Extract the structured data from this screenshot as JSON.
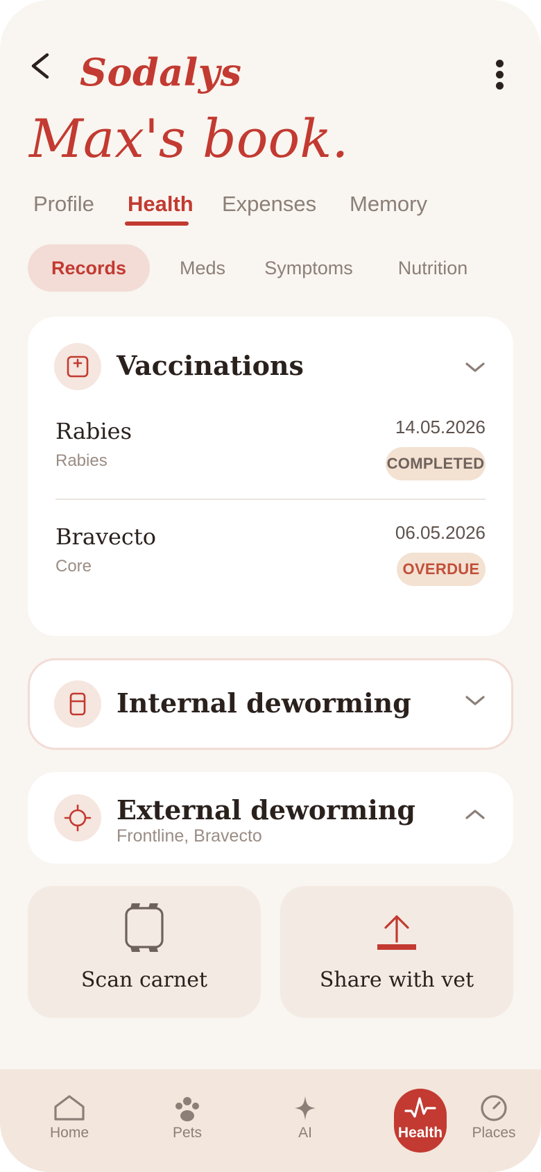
{
  "header": {
    "brand": "Sodalys",
    "title": "Max's book."
  },
  "tabs": [
    {
      "label": "Profile",
      "active": false
    },
    {
      "label": "Health",
      "active": true
    },
    {
      "label": "Expenses",
      "active": false
    },
    {
      "label": "Memory",
      "active": false
    }
  ],
  "subtabs": [
    {
      "label": "Records",
      "active": true
    },
    {
      "label": "Meds",
      "active": false
    },
    {
      "label": "Symptoms",
      "active": false
    },
    {
      "label": "Nutrition",
      "active": false
    }
  ],
  "sections": {
    "vaccinations": {
      "title": "Vaccinations",
      "icon": "medical-plus-icon",
      "expanded": true,
      "records": [
        {
          "name": "Rabies",
          "type": "Rabies",
          "date": "14.05.2026",
          "status": "COMPLETED"
        },
        {
          "name": "Bravecto",
          "type": "Core",
          "date": "06.05.2026",
          "status": "OVERDUE"
        }
      ]
    },
    "internal": {
      "title": "Internal deworming",
      "icon": "capsule-icon",
      "expanded": false
    },
    "external": {
      "title": "External deworming",
      "subtitle": "Frontline, Bravecto",
      "icon": "crosshair-icon",
      "expanded": true
    }
  },
  "actions": {
    "scan_label": "Scan carnet",
    "share_label": "Share with vet"
  },
  "nav": [
    {
      "label": "Home",
      "icon": "home-icon",
      "active": false
    },
    {
      "label": "Pets",
      "icon": "paw-icon",
      "active": false
    },
    {
      "label": "AI",
      "icon": "sparkle-icon",
      "active": false
    },
    {
      "label": "Health",
      "icon": "pulse-icon",
      "active": true
    },
    {
      "label": "Places",
      "icon": "compass-icon",
      "active": false
    }
  ],
  "colors": {
    "accent": "#c23a31",
    "background": "#f9f5f0",
    "card": "#ffffff",
    "chip_active": "#f3dcd6",
    "nav_bar": "#f3e6dc"
  }
}
